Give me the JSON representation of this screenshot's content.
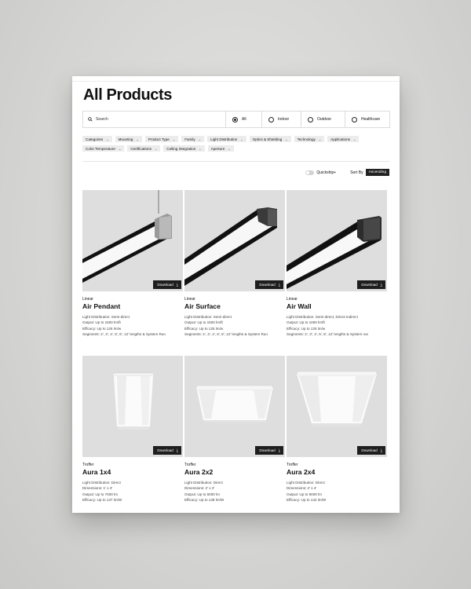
{
  "page_title": "All Products",
  "search": {
    "placeholder": "Search"
  },
  "scope": [
    {
      "label": "All",
      "selected": true
    },
    {
      "label": "Indoor",
      "selected": false
    },
    {
      "label": "Outdoor",
      "selected": false
    },
    {
      "label": "Healthcare",
      "selected": false
    }
  ],
  "filters": [
    "Categories",
    "Mounting",
    "Product Type",
    "Family",
    "Light Distribution",
    "Optics & Shielding",
    "Technology",
    "Applications",
    "Color Temperature",
    "Certifications",
    "Ceiling Integration",
    "Aperture"
  ],
  "quickship_label": "Quickship+",
  "sort": {
    "label": "Sort By",
    "value": "Ascending"
  },
  "download_label": "Download",
  "products": [
    {
      "family": "Linear",
      "name": "Air Pendant",
      "image": "pendant",
      "specs": [
        "Light Distribution: Semi-direct",
        "Output: Up to 1500 lm/ft",
        "Efficacy: Up to 125 lm/w",
        "Segments: 2', 3', 4', 6', 8', 12' lengths & System Run"
      ]
    },
    {
      "family": "Linear",
      "name": "Air Surface",
      "image": "surface",
      "specs": [
        "Light Distribution: Semi-direct",
        "Output: Up to 1500 lm/ft",
        "Efficacy: Up to 125 lm/w",
        "Segments: 2', 3', 4', 6', 8', 12' lengths & System Run"
      ]
    },
    {
      "family": "Linear",
      "name": "Air Wall",
      "image": "wall",
      "specs": [
        "Light Distribution: Semi-direct, Direct-indirect",
        "Output: Up to 1000 lm/ft",
        "Efficacy: Up to 125 lm/w",
        "Segments: 2', 3', 4', 6', 8', 12' lengths & System run"
      ]
    },
    {
      "family": "Troffer",
      "name": "Aura 1x4",
      "image": "troffer-1x4",
      "specs": [
        "Light Distribution: Direct",
        "Dimensions: 1' x 4'",
        "Output: Up to 7000 lm",
        "Efficacy: Up to 137 lm/W"
      ]
    },
    {
      "family": "Troffer",
      "name": "Aura 2x2",
      "image": "troffer-2x2",
      "specs": [
        "Light Distribution: Direct",
        "Dimensions: 2' x 2'",
        "Output: Up to 5000 lm",
        "Efficacy: Up to 138 lm/W"
      ]
    },
    {
      "family": "Troffer",
      "name": "Aura 2x4",
      "image": "troffer-2x4",
      "specs": [
        "Light Distribution: Direct",
        "Dimensions: 2' x 4'",
        "Output: Up to 9000 lm",
        "Efficacy: Up to 142 lm/W"
      ]
    }
  ]
}
